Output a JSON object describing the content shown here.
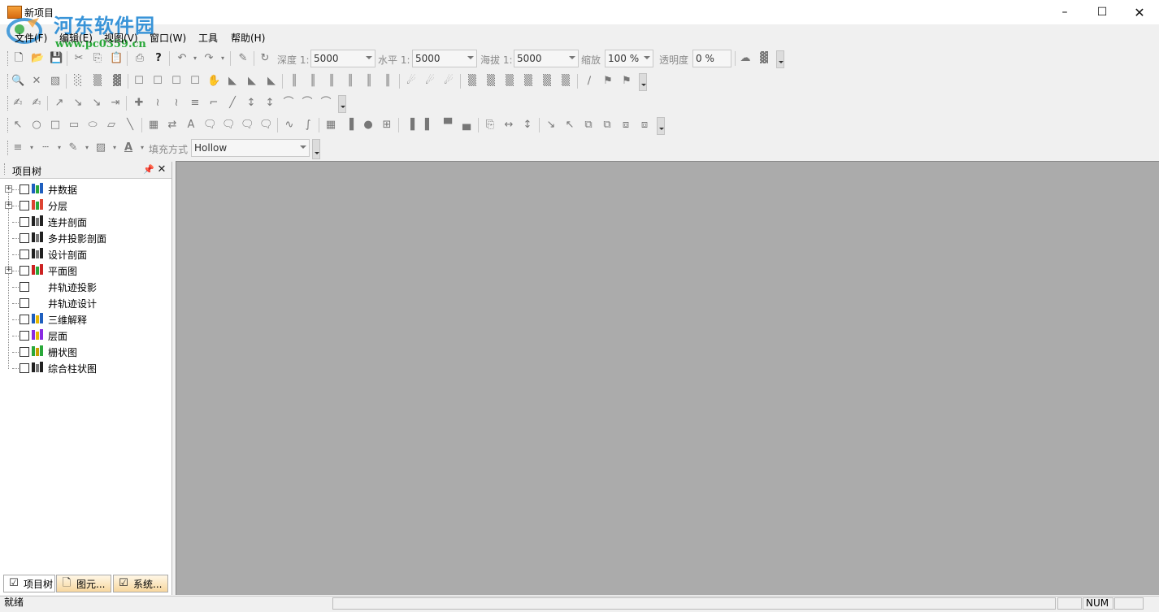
{
  "window": {
    "title": "新项目"
  },
  "watermark": {
    "name": "河东软件园",
    "url": "www.pc0359.cn"
  },
  "menu": [
    "文件(F)",
    "编辑(E)",
    "视图(V)",
    "窗口(W)",
    "工具",
    "帮助(H)"
  ],
  "toolbar_view": {
    "depth_label": "深度 1:",
    "depth_value": "5000",
    "horizontal_label": "水平 1:",
    "horizontal_value": "5000",
    "elevation_label": "海拔 1:",
    "elevation_value": "5000",
    "zoom_label": "缩放",
    "zoom_value": "100 %",
    "transparency_label": "透明度",
    "transparency_value": "0 %"
  },
  "toolbar_style": {
    "fill_label": "填充方式",
    "fill_value": "Hollow"
  },
  "project_tree": {
    "title": "项目树",
    "items": [
      {
        "label": "井数据",
        "expandable": true
      },
      {
        "label": "分层",
        "expandable": true
      },
      {
        "label": "连井剖面",
        "expandable": false
      },
      {
        "label": "多井投影剖面",
        "expandable": false
      },
      {
        "label": "设计剖面",
        "expandable": false
      },
      {
        "label": "平面图",
        "expandable": true
      },
      {
        "label": "井轨迹投影",
        "expandable": false
      },
      {
        "label": "井轨迹设计",
        "expandable": false
      },
      {
        "label": "三维解释",
        "expandable": false
      },
      {
        "label": "层面",
        "expandable": false
      },
      {
        "label": "栅状图",
        "expandable": false
      },
      {
        "label": "综合柱状图",
        "expandable": false
      }
    ]
  },
  "bottom_tabs": [
    "项目树",
    "图元...",
    "系统..."
  ],
  "status": {
    "ready": "就绪",
    "num": "NUM"
  },
  "colors": {
    "workspace": "#ababab",
    "accent_orange": "#f6a33a"
  }
}
